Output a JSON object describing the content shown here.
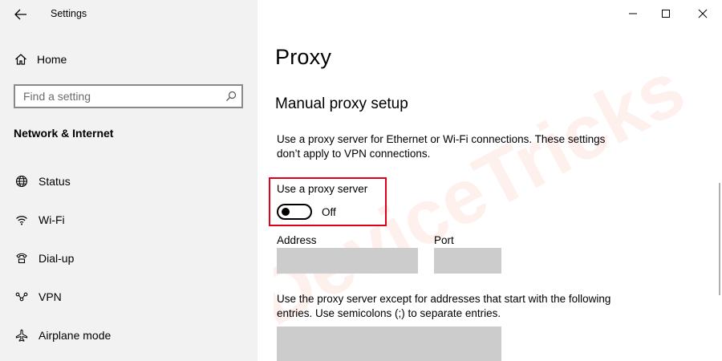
{
  "window": {
    "title": "Settings",
    "controls": [
      "minimize",
      "maximize",
      "close"
    ]
  },
  "sidebar": {
    "home_label": "Home",
    "search_placeholder": "Find a setting",
    "section_title": "Network & Internet",
    "items": [
      {
        "label": "Status",
        "icon": "globe-icon"
      },
      {
        "label": "Wi-Fi",
        "icon": "wifi-icon"
      },
      {
        "label": "Dial-up",
        "icon": "phone-icon"
      },
      {
        "label": "VPN",
        "icon": "vpn-icon"
      },
      {
        "label": "Airplane mode",
        "icon": "airplane-icon"
      }
    ]
  },
  "main": {
    "page_title": "Proxy",
    "section_title": "Manual proxy setup",
    "description": "Use a proxy server for Ethernet or Wi-Fi connections. These settings don’t apply to VPN connections.",
    "toggle": {
      "label": "Use a proxy server",
      "state_text": "Off",
      "on": false
    },
    "address_label": "Address",
    "port_label": "Port",
    "exceptions_description": "Use the proxy server except for addresses that start with the following entries. Use semicolons (;) to separate entries."
  },
  "colors": {
    "sidebar_bg": "#f2f2f2",
    "field_bg": "#cccccc",
    "highlight_border": "#e0001b"
  },
  "watermark": "DeviceTricks"
}
